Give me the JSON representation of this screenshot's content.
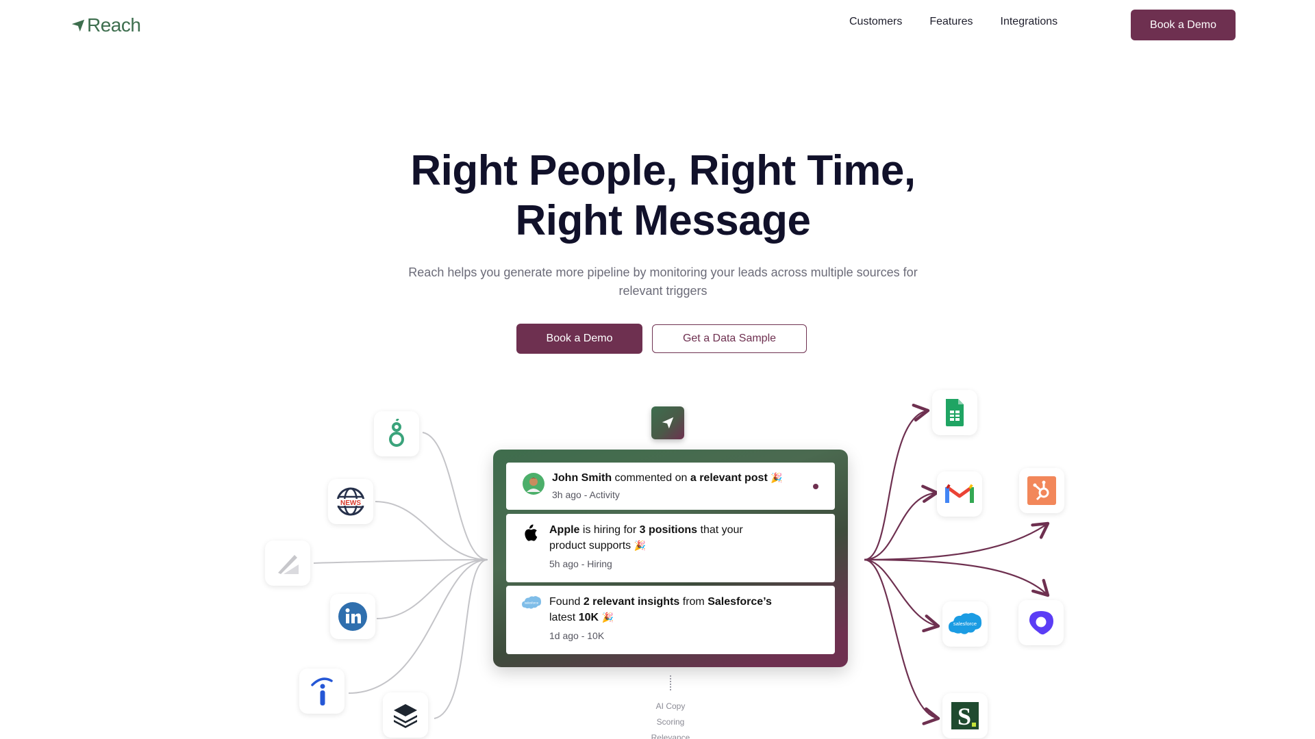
{
  "nav": {
    "logo_text": "Reach",
    "links": [
      "Customers",
      "Features",
      "Integrations"
    ],
    "cta_label": "Book a Demo"
  },
  "hero": {
    "title_line1": "Right People, Right Time,",
    "title_line2": "Right Message",
    "subtitle": "Reach helps you generate more pipeline by monitoring your leads across multiple sources for relevant triggers",
    "primary_button": "Book a Demo",
    "secondary_button": "Get a Data Sample"
  },
  "sources": [
    {
      "name": "greenhouse-icon"
    },
    {
      "name": "news-icon"
    },
    {
      "name": "pen-icon"
    },
    {
      "name": "linkedin-icon"
    },
    {
      "name": "indeed-icon"
    },
    {
      "name": "stack-icon"
    }
  ],
  "destinations": [
    {
      "name": "google-sheets-icon"
    },
    {
      "name": "gmail-icon"
    },
    {
      "name": "hubspot-icon"
    },
    {
      "name": "salesforce-icon"
    },
    {
      "name": "outreach-icon"
    },
    {
      "name": "salesloft-icon"
    }
  ],
  "feed": {
    "items": [
      {
        "name": "John Smith",
        "mid": " commented on ",
        "strong": "a relevant post",
        "emoji": "🎉",
        "meta": "3h ago - Activity"
      },
      {
        "name": "Apple",
        "mid": " is hiring for ",
        "strong": "3 positions",
        "rest": " that your product supports",
        "emoji": "🎉",
        "meta": "5h ago - Hiring"
      },
      {
        "lead": "Found ",
        "strong": "2 relevant insights",
        "mid": " from ",
        "name": "Salesforce’s",
        "rest": " latest ",
        "strong2": "10K",
        "emoji": "🎉",
        "meta": "1d ago - 10K"
      }
    ]
  },
  "ai_features": [
    "AI Copy",
    "Scoring",
    "Relevance"
  ],
  "colors": {
    "brand": "#6e3050",
    "logo_green": "#3d6e4e",
    "line_gray": "#c4c4c8",
    "arrow": "#6e3050"
  }
}
